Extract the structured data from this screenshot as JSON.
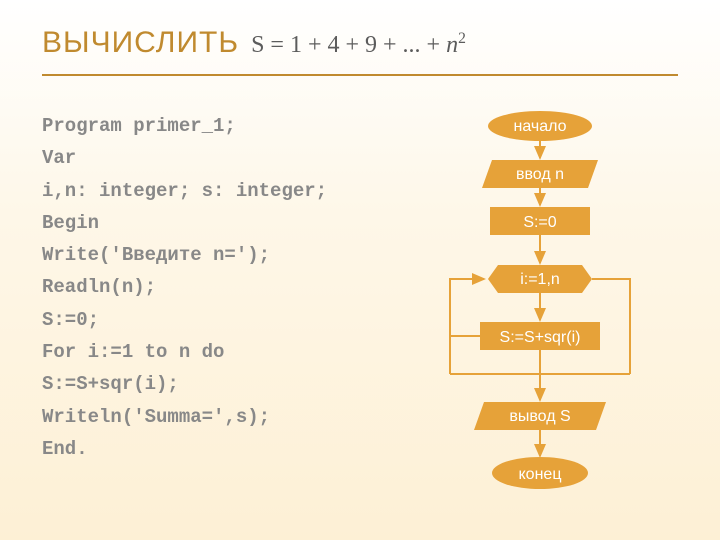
{
  "title": "ВЫЧИСЛИТЬ",
  "formula_html": "<span class='eq'>S = 1 + 4 + 9 + ... + </span>n<sup>2</sup>",
  "code_lines": [
    "Program primer_1;",
    "Var",
    "i,n: integer; s: integer;",
    "Begin",
    "Write('Введите n=');",
    "Readln(n);",
    "S:=0;",
    "For i:=1 to n do",
    "S:=S+sqr(i);",
    "Writeln('Summa=',s);",
    "End."
  ],
  "flow": {
    "start": "начало",
    "input": "ввод n",
    "init": "S:=0",
    "loop": "i:=1,n",
    "body": "S:=S+sqr(i)",
    "output": "вывод S",
    "end": "конец"
  },
  "colors": {
    "accent": "#e6a239",
    "title": "#c08a2f",
    "code": "#888888"
  }
}
